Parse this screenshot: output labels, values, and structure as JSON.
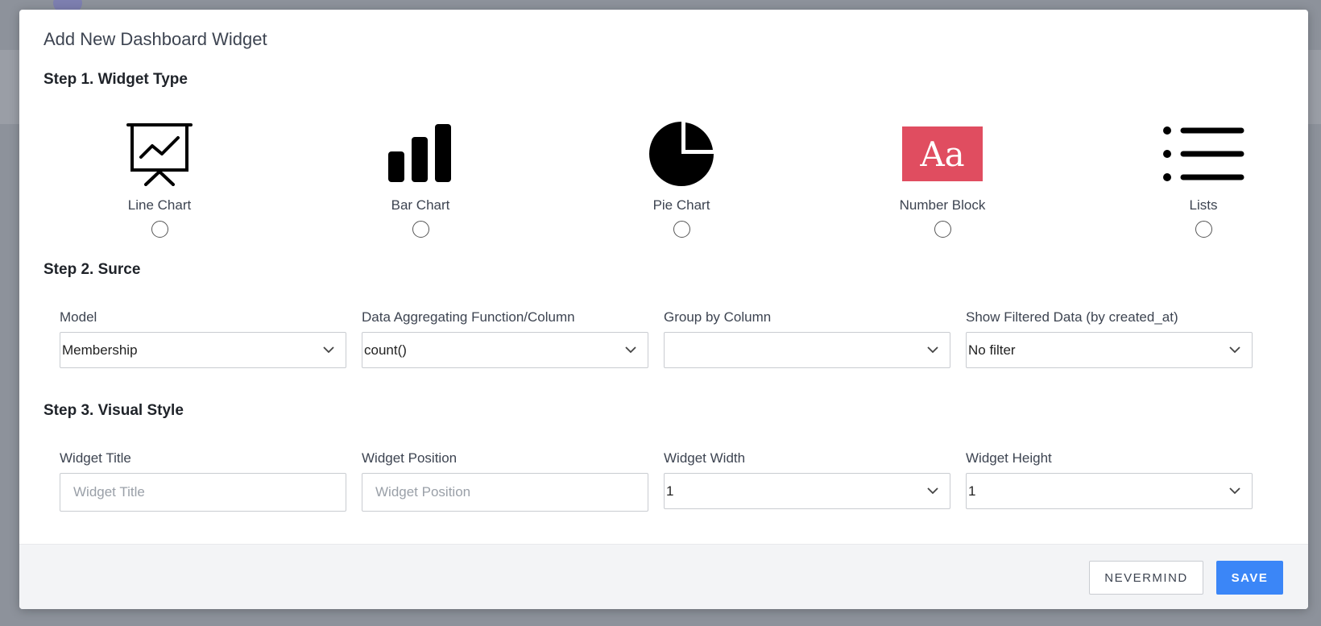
{
  "modal": {
    "title": "Add New Dashboard Widget"
  },
  "step1": {
    "heading": "Step 1. Widget Type",
    "types": [
      {
        "label": "Line Chart",
        "icon": "line-chart-presentation-icon"
      },
      {
        "label": "Bar Chart",
        "icon": "bar-chart-icon"
      },
      {
        "label": "Pie Chart",
        "icon": "pie-chart-icon"
      },
      {
        "label": "Number Block",
        "icon": "number-block-icon",
        "icon_text": "Aa",
        "color": "#e04d60"
      },
      {
        "label": "Lists",
        "icon": "list-icon"
      }
    ]
  },
  "step2": {
    "heading": "Step 2. Surce",
    "model": {
      "label": "Model",
      "value": "Membership"
    },
    "aggregate": {
      "label": "Data Aggregating Function/Column",
      "value": "count()"
    },
    "group_by": {
      "label": "Group by Column",
      "value": ""
    },
    "filter": {
      "label": "Show Filtered Data (by created_at)",
      "value": "No filter"
    }
  },
  "step3": {
    "heading": "Step 3. Visual Style",
    "title": {
      "label": "Widget Title",
      "placeholder": "Widget Title"
    },
    "position": {
      "label": "Widget Position",
      "placeholder": "Widget Position"
    },
    "width": {
      "label": "Widget Width",
      "value": "1"
    },
    "height": {
      "label": "Widget Height",
      "value": "1"
    }
  },
  "footer": {
    "nevermind_label": "NEVERMIND",
    "save_label": "SAVE"
  },
  "colors": {
    "accent": "#3b86f7",
    "number_block": "#e04d60"
  }
}
